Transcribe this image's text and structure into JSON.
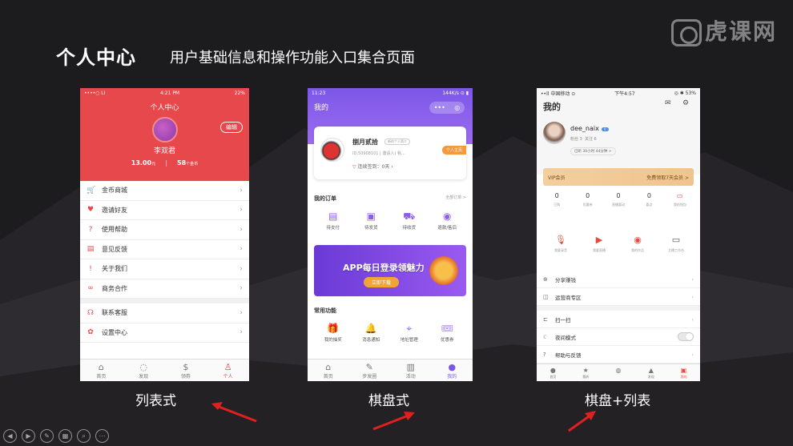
{
  "slide": {
    "title": "个人中心",
    "subtitle": "用户基础信息和操作功能入口集合页面",
    "watermark": "虎课网"
  },
  "phone1": {
    "status": {
      "carrier": "••••○ LI",
      "time": "4:21 PM",
      "battery": "22%"
    },
    "title": "个人中心",
    "edit_label": "编辑",
    "user_name": "李双君",
    "balance": "13.00",
    "balance_unit": "元",
    "coins": "58",
    "coins_unit": "个金币",
    "menu": [
      {
        "icon": "cart-icon",
        "glyph": "🛒",
        "label": "金币商城"
      },
      {
        "icon": "invite-icon",
        "glyph": "♥",
        "label": "邀请好友"
      },
      {
        "icon": "help-icon",
        "glyph": "?",
        "label": "使用帮助"
      },
      {
        "icon": "feedback-icon",
        "glyph": "▤",
        "label": "意见反馈"
      },
      {
        "icon": "about-icon",
        "glyph": "!",
        "label": "关于我们"
      },
      {
        "icon": "cooperation-icon",
        "glyph": "∞",
        "label": "商务合作"
      },
      {
        "icon": "headset-icon",
        "glyph": "☊",
        "label": "联系客服"
      },
      {
        "icon": "settings-icon",
        "glyph": "✿",
        "label": "设置中心"
      }
    ],
    "tabs": [
      {
        "icon": "home-icon",
        "glyph": "⌂",
        "label": "首页"
      },
      {
        "icon": "discover-icon",
        "glyph": "◌",
        "label": "发现"
      },
      {
        "icon": "wallet-icon",
        "glyph": "$",
        "label": "领券"
      },
      {
        "icon": "person-icon",
        "glyph": "♙",
        "label": "个人"
      }
    ],
    "accent": "#e6484b"
  },
  "phone2": {
    "status": {
      "time": "11:23",
      "right": "144K/s ⊙ ▮"
    },
    "title": "我的",
    "user_name": "捌月贰拾",
    "badge": "新的个人简介",
    "user_id": "ID:50908101 | 邀请人) 我…",
    "sign_in": "连续签到：0天",
    "home_button": "个人主页",
    "orders_title": "我的订单",
    "orders_all": "全部订单 >",
    "orders": [
      {
        "icon": "pay-icon",
        "glyph": "▤",
        "label": "待支付"
      },
      {
        "icon": "ship-icon",
        "glyph": "▣",
        "label": "待发货"
      },
      {
        "icon": "truck-icon",
        "glyph": "⛟",
        "label": "待收货"
      },
      {
        "icon": "refund-icon",
        "glyph": "◉",
        "label": "退款/售后"
      }
    ],
    "banner_title": "APP每日登录领魅力",
    "banner_button": "立即下载",
    "common_title": "常用功能",
    "common": [
      {
        "icon": "gift-icon",
        "glyph": "🎁",
        "label": "我的抽奖"
      },
      {
        "icon": "bell-icon",
        "glyph": "🔔",
        "label": "消息通知"
      },
      {
        "icon": "location-icon",
        "glyph": "⌖",
        "label": "地址管理"
      },
      {
        "icon": "coupon-icon",
        "glyph": "🎟",
        "label": "优惠券"
      }
    ],
    "tabs": [
      {
        "icon": "home-icon",
        "glyph": "⌂",
        "label": "首页"
      },
      {
        "icon": "discover-icon",
        "glyph": "✎",
        "label": "步发圈"
      },
      {
        "icon": "activity-icon",
        "glyph": "▥",
        "label": "活动"
      },
      {
        "icon": "person-icon",
        "glyph": "●",
        "label": "我的"
      }
    ],
    "accent": "#7b57e8"
  },
  "phone3": {
    "status": {
      "carrier": "••ll 中国移动 ⊙",
      "time": "下午4:57",
      "battery": "◎ ✱ 53%"
    },
    "title": "我的",
    "user_name": "dee_naix",
    "vip_tag": "V",
    "fans": "粉丝 3",
    "follow": "关注 6",
    "days": "已听 30小时 44分钟 >",
    "vip_label": "VIP会员",
    "vip_offer": "免费领取7天会员 >",
    "stats": [
      {
        "value": "0",
        "label": "已购"
      },
      {
        "value": "0",
        "label": "优惠券"
      },
      {
        "value": "0",
        "label": "直播喜动"
      },
      {
        "value": "0",
        "label": "喜点"
      },
      {
        "value": "",
        "label": "我的钱包"
      }
    ],
    "actions": [
      {
        "icon": "mic-icon",
        "glyph": "🎙",
        "label": "我要录音"
      },
      {
        "icon": "video-icon",
        "glyph": "▶",
        "label": "我要直播"
      },
      {
        "icon": "works-icon",
        "glyph": "◉",
        "label": "我的作品"
      },
      {
        "icon": "studio-icon",
        "glyph": "▭",
        "label": "主播工作台"
      }
    ],
    "menu": [
      {
        "icon": "share-icon",
        "glyph": "⊕",
        "label": "分享赚钱"
      },
      {
        "icon": "operator-icon",
        "glyph": "◫",
        "label": "运营商专区"
      },
      {
        "icon": "scan-icon",
        "glyph": "⊏",
        "label": "扫一扫"
      },
      {
        "icon": "moon-icon",
        "glyph": "☾",
        "label": "夜间模式"
      },
      {
        "icon": "help-icon",
        "glyph": "?",
        "label": "帮助与反馈"
      }
    ],
    "tabs": [
      {
        "icon": "home-icon",
        "glyph": "●",
        "label": "首页"
      },
      {
        "icon": "star-icon",
        "glyph": "★",
        "label": "我听"
      },
      {
        "icon": "avatar-icon",
        "glyph": "◍",
        "label": ""
      },
      {
        "icon": "discover-icon",
        "glyph": "▲",
        "label": "发现"
      },
      {
        "icon": "person-icon",
        "glyph": "▣",
        "label": "我的"
      }
    ],
    "accent": "#e84a3a"
  },
  "captions": {
    "list": "列表式",
    "grid": "棋盘式",
    "mixed": "棋盘+列表"
  }
}
